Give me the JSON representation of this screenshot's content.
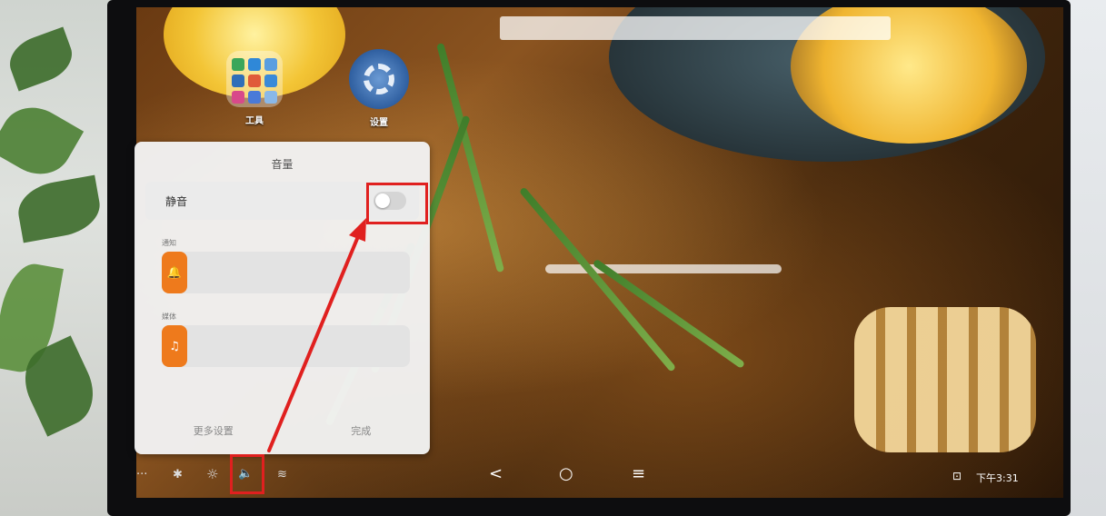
{
  "desktop": {
    "apps": [
      {
        "label": "工具",
        "icon": "folder-icon"
      },
      {
        "label": "设置",
        "icon": "settings-gear-icon"
      }
    ]
  },
  "volume_panel": {
    "title": "音量",
    "mute": {
      "label": "静音",
      "enabled": false
    },
    "sliders": [
      {
        "caption": "通知",
        "icon": "bell-icon",
        "symbol": "🔔",
        "level": 0.05
      },
      {
        "caption": "媒体",
        "icon": "music-note-icon",
        "symbol": "♫",
        "level": 0.05
      }
    ],
    "footer": {
      "more_settings": "更多设置",
      "done": "完成"
    }
  },
  "taskbar": {
    "status_icons": [
      {
        "name": "more-icon",
        "glyph": "···"
      },
      {
        "name": "bluetooth-icon",
        "glyph": "✱"
      },
      {
        "name": "brightness-icon",
        "glyph": "☼"
      },
      {
        "name": "volume-icon",
        "glyph": "🔈"
      },
      {
        "name": "wifi-icon",
        "glyph": "≋"
      }
    ],
    "nav": [
      {
        "name": "back-icon",
        "glyph": "<"
      },
      {
        "name": "home-icon",
        "glyph": "○"
      },
      {
        "name": "menu-icon",
        "glyph": "≡"
      }
    ],
    "clock": "下午3:31",
    "clock_icon_glyph": "⊡"
  },
  "colors": {
    "accent_orange": "#ee7a1c",
    "annotation_red": "#e0201f"
  }
}
